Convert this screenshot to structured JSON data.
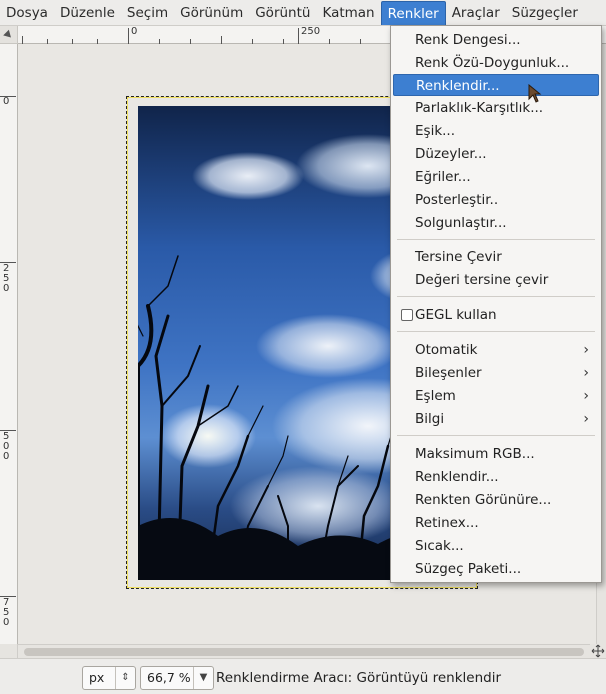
{
  "menubar": {
    "items": [
      {
        "label": "Dosya"
      },
      {
        "label": "Düzenle"
      },
      {
        "label": "Seçim"
      },
      {
        "label": "Görünüm"
      },
      {
        "label": "Görüntü"
      },
      {
        "label": "Katman"
      },
      {
        "label": "Renkler",
        "active": true
      },
      {
        "label": "Araçlar"
      },
      {
        "label": "Süzgeçler"
      }
    ]
  },
  "rulers": {
    "h_labels": [
      "0",
      "250"
    ],
    "v_labels": [
      "0",
      "250",
      "500",
      "750"
    ]
  },
  "menu": {
    "title": "Renkler",
    "groups": [
      [
        "Renk Dengesi...",
        "Renk Özü-Doygunluk...",
        "Renklendir...",
        "Parlaklık-Karşıtlık...",
        "Eşik...",
        "Düzeyler...",
        "Eğriler...",
        "Posterleştir..",
        "Solgunlaştır..."
      ],
      [
        "Tersine Çevir",
        "Değeri tersine çevir"
      ],
      [
        "GEGL kullan"
      ],
      [
        "Otomatik",
        "Bileşenler",
        "Eşlem",
        "Bilgi"
      ],
      [
        "Maksimum RGB...",
        "Renklendir...",
        "Renkten Görünüre...",
        "Retinex...",
        "Sıcak...",
        "Süzgeç Paketi..."
      ]
    ],
    "highlighted": "Renklendir...",
    "submenu_items": [
      "Otomatik",
      "Bileşenler",
      "Eşlem",
      "Bilgi"
    ],
    "checkbox_items": [
      {
        "label": "GEGL kullan",
        "checked": false
      }
    ]
  },
  "statusbar": {
    "unit": "px",
    "zoom": "66,7 %",
    "message": "Renklendirme Aracı: Görüntüyü renklendir"
  },
  "colors": {
    "accent": "#3d7fd1",
    "menu_bg": "#f6f5f3",
    "canvas_bg": "#e9e7e3"
  },
  "icons": {
    "submenu_arrow": "chevron-right-icon",
    "cursor": "mouse-pointer-icon"
  }
}
